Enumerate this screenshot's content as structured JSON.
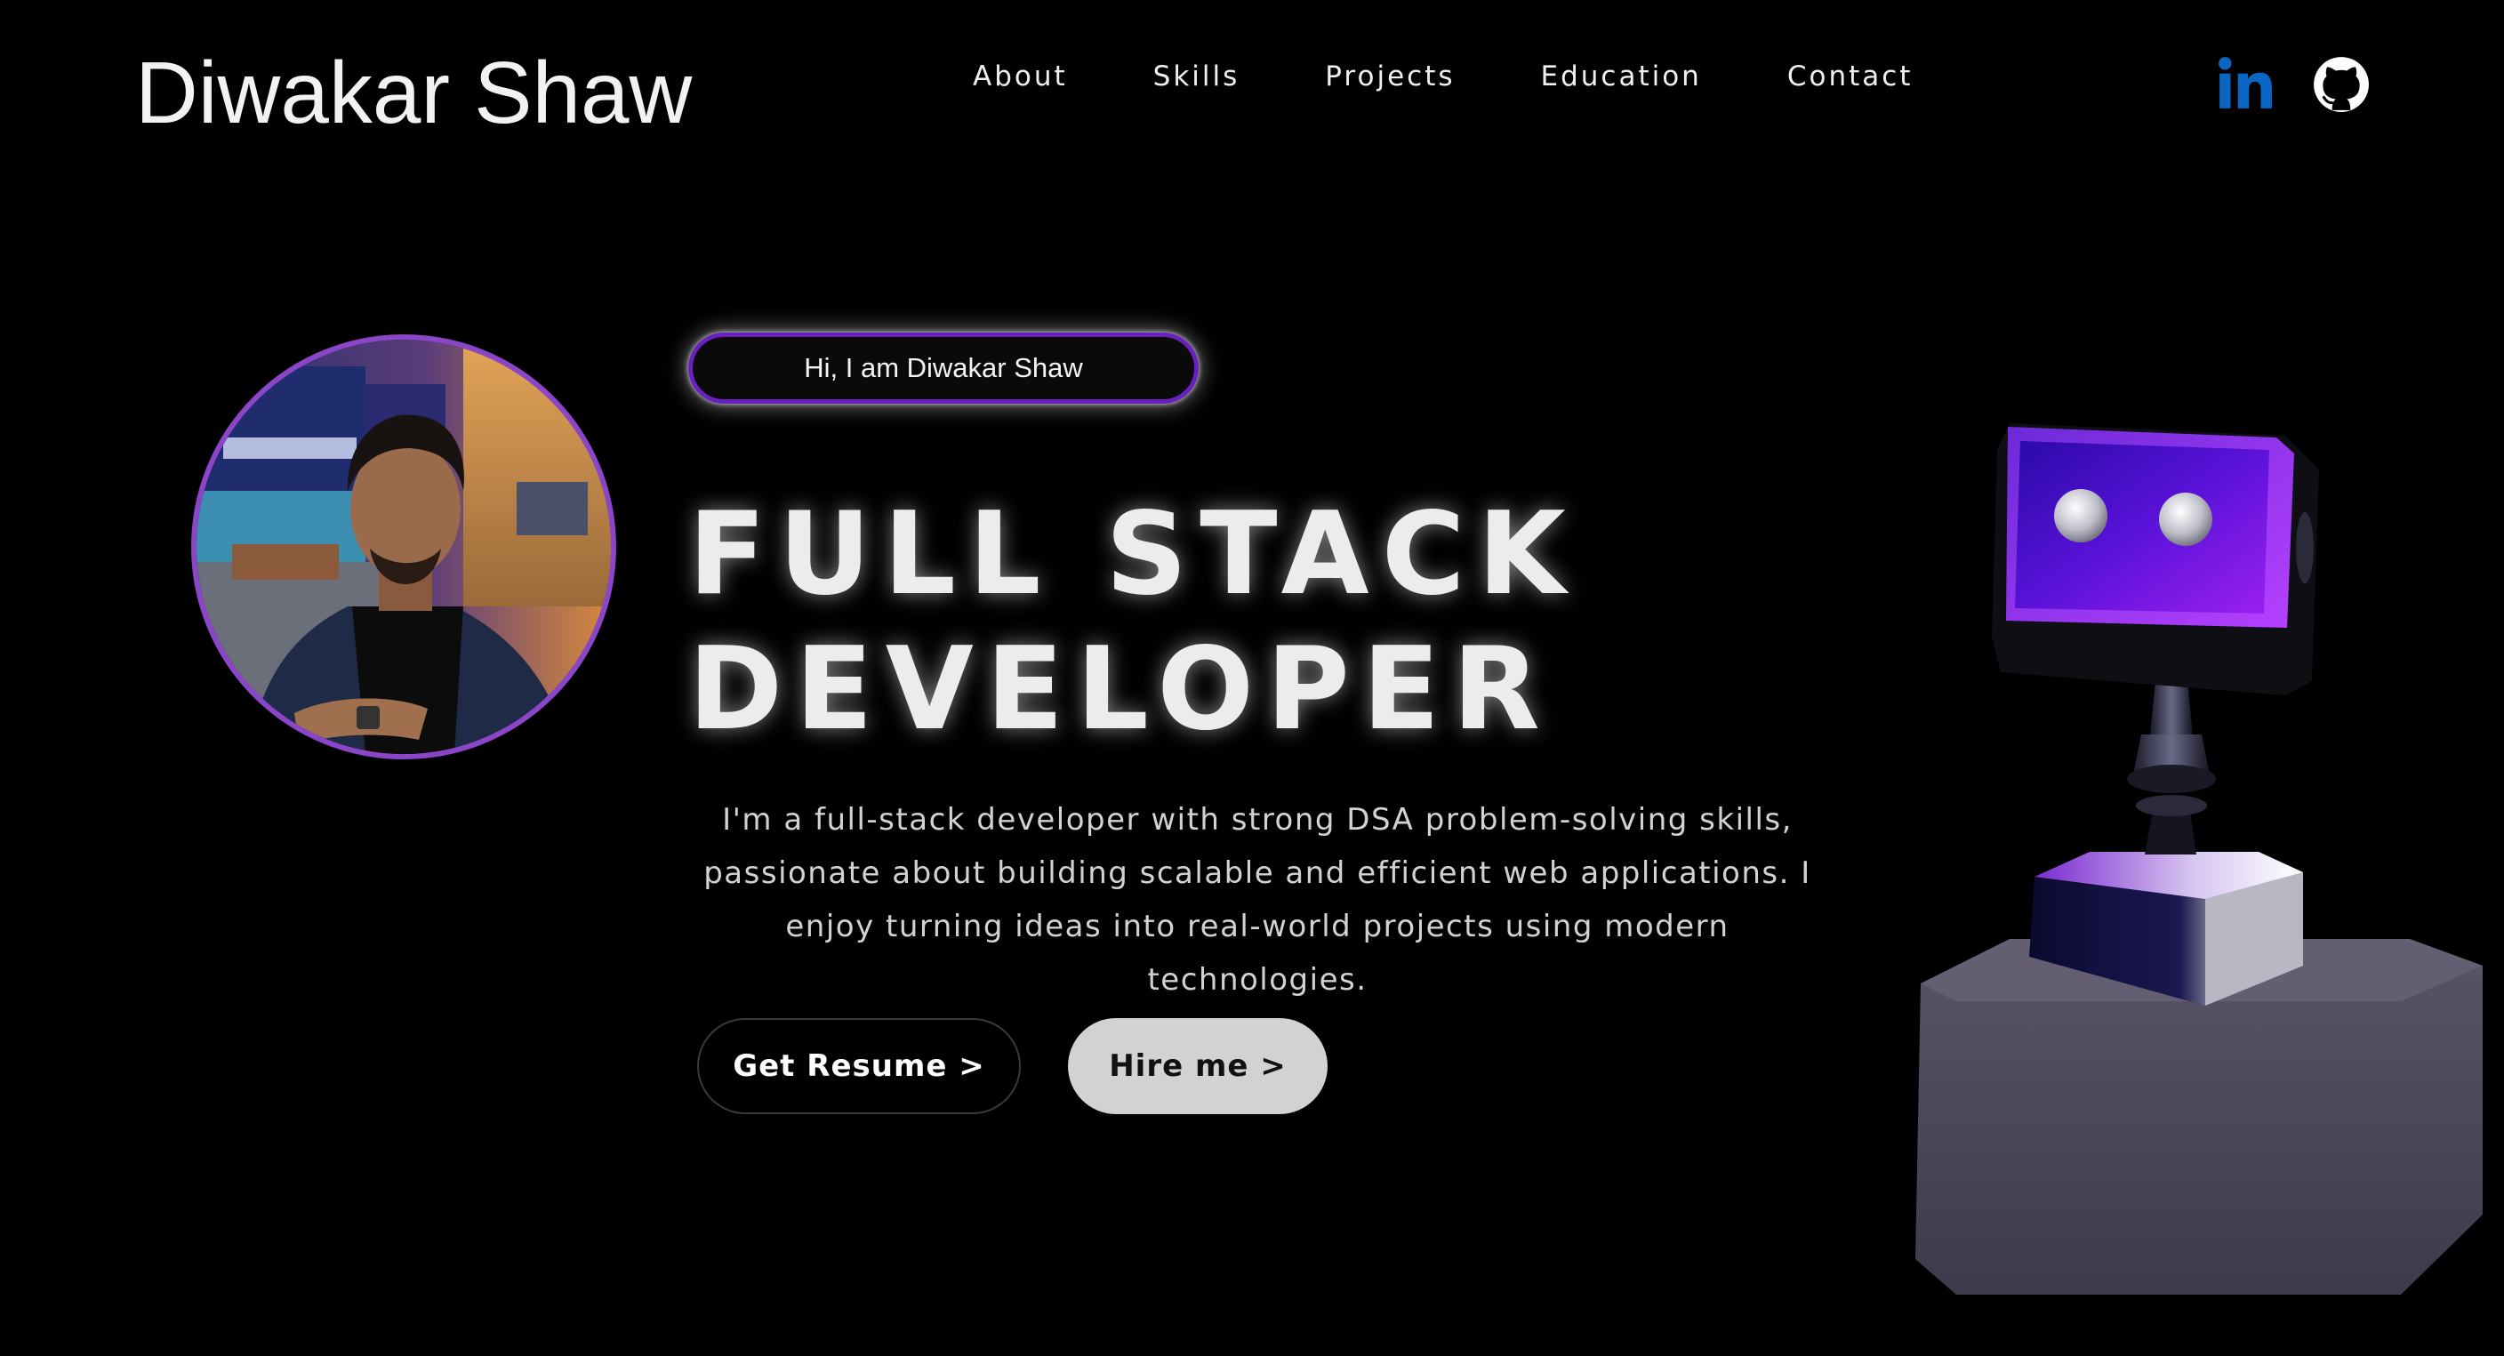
{
  "header": {
    "brand": "Diwakar Shaw",
    "nav": [
      "About",
      "Skills",
      "Projects",
      "Education",
      "Contact"
    ],
    "social": [
      {
        "icon": "linkedin-icon",
        "color": "#0a66c2"
      },
      {
        "icon": "github-icon",
        "color": "#ffffff"
      }
    ]
  },
  "hero": {
    "greeting": "Hi, I am Diwakar Shaw",
    "title_line1": "FULL STACK",
    "title_line2": "DEVELOPER",
    "description": "I'm a full-stack developer with strong DSA problem-solving skills, passionate about building scalable and efficient web applications. I enjoy turning ideas into real-world projects using modern technologies.",
    "buttons": {
      "resume": "Get Resume >",
      "hire": "Hire me >"
    }
  },
  "colors": {
    "background": "#000000",
    "accent_purple": "#6a1fc0",
    "avatar_ring": "#8a45c8",
    "hire_button": "#d2d2d2"
  }
}
